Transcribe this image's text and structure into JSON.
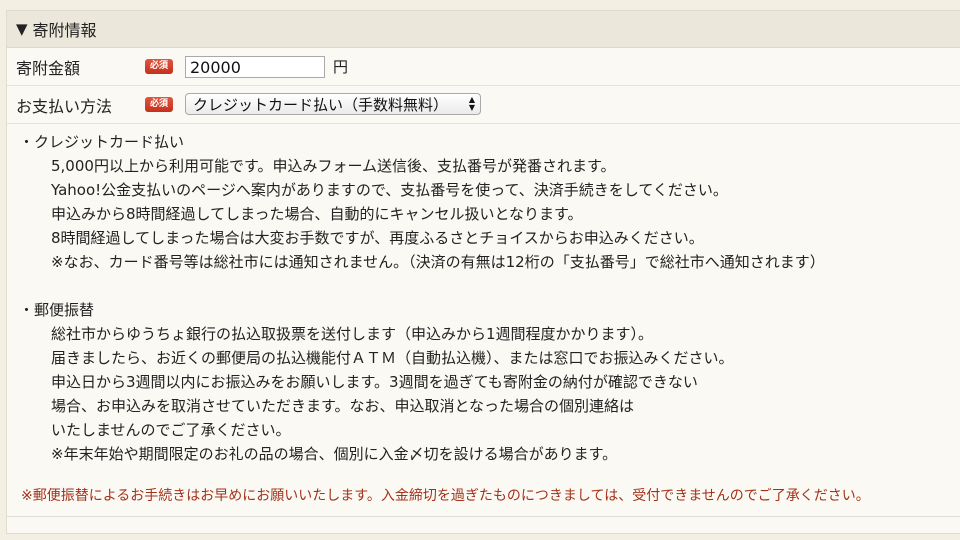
{
  "section": {
    "toggle": "▼",
    "title": "寄附情報"
  },
  "amount": {
    "label": "寄附金額",
    "required_badge": "必須",
    "value": "20000",
    "unit": "円"
  },
  "payment": {
    "label": "お支払い方法",
    "required_badge": "必須",
    "selected": "クレジットカード払い（手数料無料）"
  },
  "credit": {
    "heading": "・クレジットカード払い",
    "lines": [
      "5,000円以上から利用可能です。申込みフォーム送信後、支払番号が発番されます。",
      "Yahoo!公金支払いのページへ案内がありますので、支払番号を使って、決済手続きをしてください。",
      "申込みから8時間経過してしまった場合、自動的にキャンセル扱いとなります。",
      "8時間経過してしまった場合は大変お手数ですが、再度ふるさとチョイスからお申込みください。",
      "※なお、カード番号等は総社市には通知されません。（決済の有無は12桁の「支払番号」で総社市へ通知されます）"
    ]
  },
  "postal": {
    "heading": "・郵便振替",
    "lines": [
      "総社市からゆうちょ銀行の払込取扱票を送付します（申込みから1週間程度かかります）。",
      "届きましたら、お近くの郵便局の払込機能付ＡＴＭ（自動払込機）、または窓口でお振込みください。",
      "申込日から3週間以内にお振込みをお願いします。3週間を過ぎても寄附金の納付が確認できない",
      "場合、お申込みを取消させていただきます。なお、申込取消となった場合の個別連絡は",
      "いたしませんのでご了承ください。",
      "※年末年始や期間限定のお礼の品の場合、個別に入金〆切を設ける場合があります。"
    ]
  },
  "warning": "※郵便振替によるお手続きはお早めにお願いいたします。入金締切を過ぎたものにつきましては、受付できませんのでご了承ください。"
}
